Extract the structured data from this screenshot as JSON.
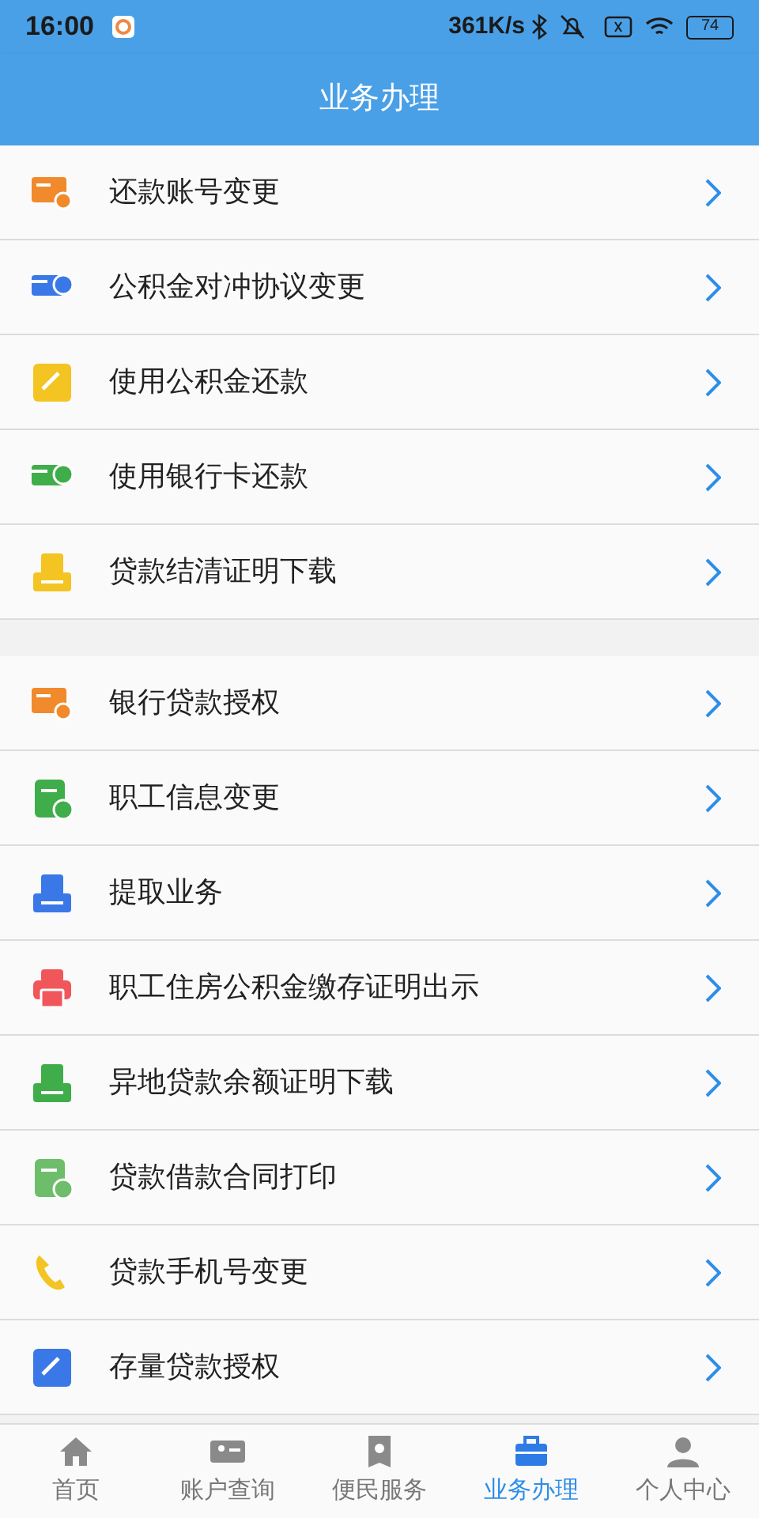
{
  "status_bar": {
    "time": "16:00",
    "speed": "361K/s",
    "battery": "74"
  },
  "header": {
    "title": "业务办理"
  },
  "groups": [
    {
      "items": [
        {
          "label": "还款账号变更"
        },
        {
          "label": "公积金对冲协议变更"
        },
        {
          "label": "使用公积金还款"
        },
        {
          "label": "使用银行卡还款"
        },
        {
          "label": "贷款结清证明下载"
        }
      ]
    },
    {
      "items": [
        {
          "label": "银行贷款授权"
        },
        {
          "label": "职工信息变更"
        },
        {
          "label": "提取业务"
        },
        {
          "label": "职工住房公积金缴存证明出示"
        },
        {
          "label": "异地贷款余额证明下载"
        },
        {
          "label": "贷款借款合同打印"
        },
        {
          "label": "贷款手机号变更"
        },
        {
          "label": "存量贷款授权"
        }
      ]
    }
  ],
  "tab_bar": [
    {
      "label": "首页",
      "selected": false
    },
    {
      "label": "账户查询",
      "selected": false
    },
    {
      "label": "便民服务",
      "selected": false
    },
    {
      "label": "业务办理",
      "selected": true
    },
    {
      "label": "个人中心",
      "selected": false
    }
  ]
}
